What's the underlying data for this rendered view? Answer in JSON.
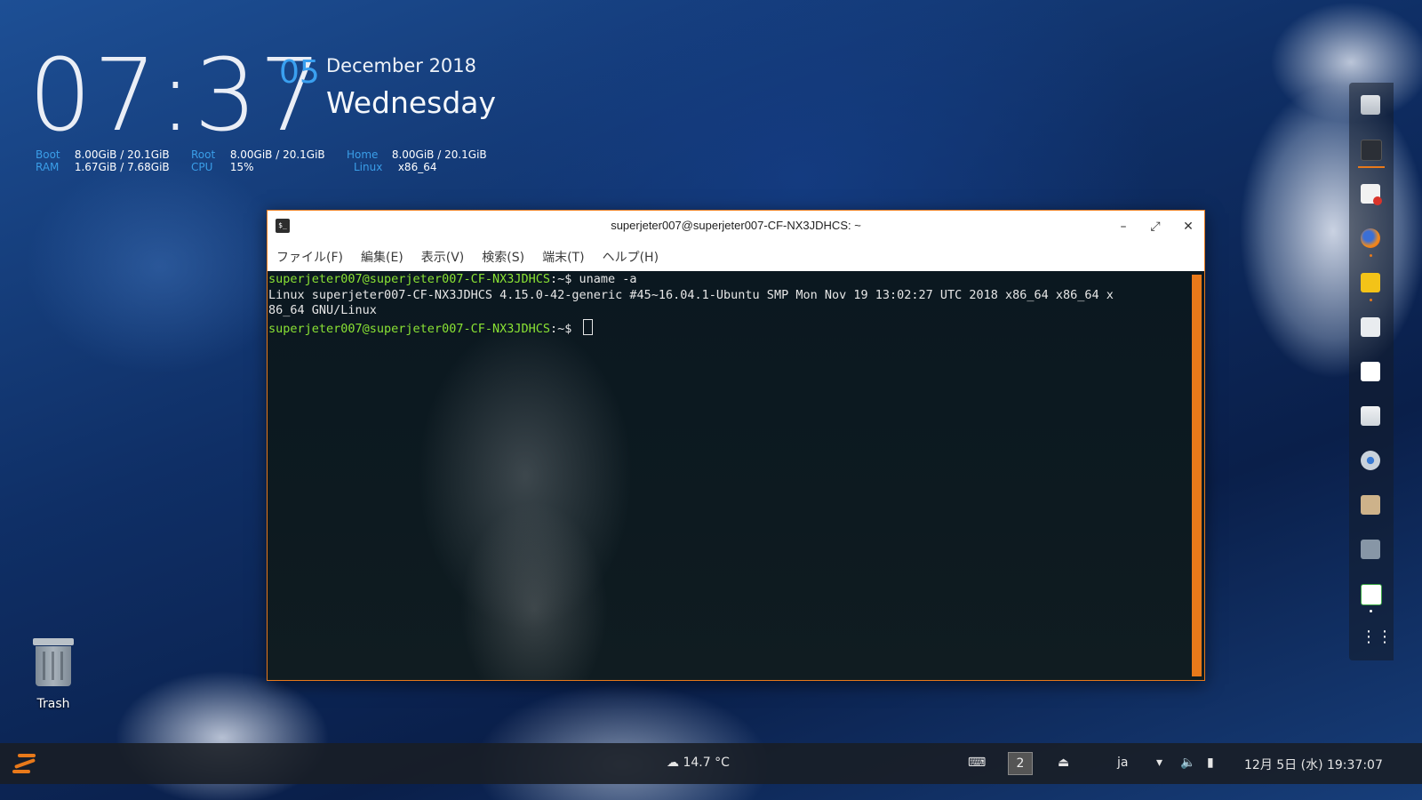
{
  "desktop": {
    "clock": {
      "time": "07:37",
      "day": "05",
      "month_year": "December 2018",
      "weekday": "Wednesday"
    },
    "stats": {
      "boot_label": "Boot",
      "boot_value": "8.00GiB / 20.1GiB",
      "root_label": "Root",
      "root_value": "8.00GiB / 20.1GiB",
      "home_label": "Home",
      "home_value": "8.00GiB / 20.1GiB",
      "ram_label": "RAM",
      "ram_value": "1.67GiB / 7.68GiB",
      "cpu_label": "CPU",
      "cpu_value": "15%",
      "linux_label": "Linux",
      "linux_value": "x86_64"
    },
    "trash_label": "Trash"
  },
  "window": {
    "title": "superjeter007@superjeter007-CF-NX3JDHCS: ~",
    "icon_glyph": "$_",
    "buttons": {
      "minimize": "–",
      "maximize": "⤢",
      "close": "✕"
    },
    "menu": [
      "ファイル(F)",
      "編集(E)",
      "表示(V)",
      "検索(S)",
      "端末(T)",
      "ヘルプ(H)"
    ]
  },
  "terminal": {
    "prompt": "superjeter007@superjeter007-CF-NX3JDHCS",
    "prompt_suffix": ":~$ ",
    "command": "uname -a",
    "output_line1": "Linux superjeter007-CF-NX3JDHCS 4.15.0-42-generic #45~16.04.1-Ubuntu SMP Mon Nov 19 13:02:27 UTC 2018 x86_64 x86_64 x",
    "output_line2": "86_64 GNU/Linux"
  },
  "dock": {
    "items": [
      "files-icon",
      "terminal-icon",
      "document-viewer-icon",
      "firefox-icon",
      "camera-app-icon",
      "calendar-icon",
      "text-file-icon",
      "settings-panel-icon",
      "system-settings-icon",
      "folder-icon",
      "screenshot-icon",
      "spreadsheet-icon",
      "app-grid-icon"
    ]
  },
  "panel": {
    "weather": "14.7 °C",
    "workspace": "2",
    "language": "ja",
    "datetime": "12月 5日 (水) 19:37:07"
  },
  "colors": {
    "accent": "#e8791a",
    "prompt_green": "#8ae234",
    "clock_blue": "#3aa0f0"
  }
}
